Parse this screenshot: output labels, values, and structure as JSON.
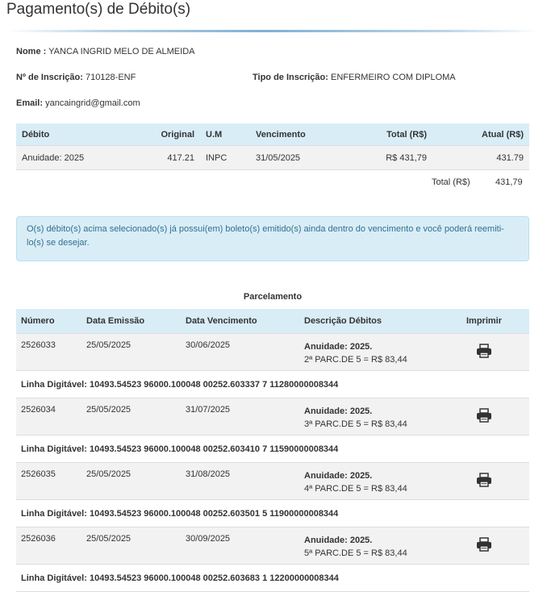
{
  "page": {
    "title": "Pagamento(s) de Débito(s)"
  },
  "person": {
    "nome_label": "Nome :",
    "nome": "YANCA INGRID MELO DE ALMEIDA",
    "inscricao_label": "Nº de Inscrição:",
    "inscricao": "710128-ENF",
    "tipo_label": "Tipo de Inscrição:",
    "tipo": "ENFERMEIRO COM DIPLOMA",
    "email_label": "Email:",
    "email": "yancaingrid@gmail.com"
  },
  "debits": {
    "headers": [
      "Débito",
      "Original",
      "U.M",
      "Vencimento",
      "Total (R$)",
      "Atual (R$)"
    ],
    "rows": [
      {
        "debito": "Anuidade: 2025",
        "original": "417.21",
        "um": "INPC",
        "vencimento": "31/05/2025",
        "total": "R$ 431,79",
        "atual": "431.79"
      }
    ],
    "total_label": "Total (R$)",
    "total_value": "431,79"
  },
  "alert": {
    "text": "O(s) débito(s) acima selecionado(s) já possui(em) boleto(s) emitido(s) ainda dentro do vencimento e você poderá reemiti-lo(s) se desejar."
  },
  "parcelamento": {
    "caption": "Parcelamento",
    "headers": [
      "Número",
      "Data Emissão",
      "Data Vencimento",
      "Descrição Débitos",
      "Imprimir"
    ],
    "line_label": "Linha Digitável:",
    "rows": [
      {
        "numero": "2526033",
        "emissao": "25/05/2025",
        "vencimento": "30/06/2025",
        "desc_title": "Anuidade: 2025.",
        "desc_sub": "2ª PARC.DE 5 = R$ 83,44",
        "linha": "10493.54523 96000.100048 00252.603337 7 11280000008344"
      },
      {
        "numero": "2526034",
        "emissao": "25/05/2025",
        "vencimento": "31/07/2025",
        "desc_title": "Anuidade: 2025.",
        "desc_sub": "3ª PARC.DE 5 = R$ 83,44",
        "linha": "10493.54523 96000.100048 00252.603410 7 11590000008344"
      },
      {
        "numero": "2526035",
        "emissao": "25/05/2025",
        "vencimento": "31/08/2025",
        "desc_title": "Anuidade: 2025.",
        "desc_sub": "4ª PARC.DE 5 = R$ 83,44",
        "linha": "10493.54523 96000.100048 00252.603501 5 11900000008344"
      },
      {
        "numero": "2526036",
        "emissao": "25/05/2025",
        "vencimento": "30/09/2025",
        "desc_title": "Anuidade: 2025.",
        "desc_sub": "5ª PARC.DE 5 = R$ 83,44",
        "linha": "10493.54523 96000.100048 00252.603683 1 12200000008344"
      }
    ]
  },
  "icons": {
    "print": "printer-icon"
  }
}
